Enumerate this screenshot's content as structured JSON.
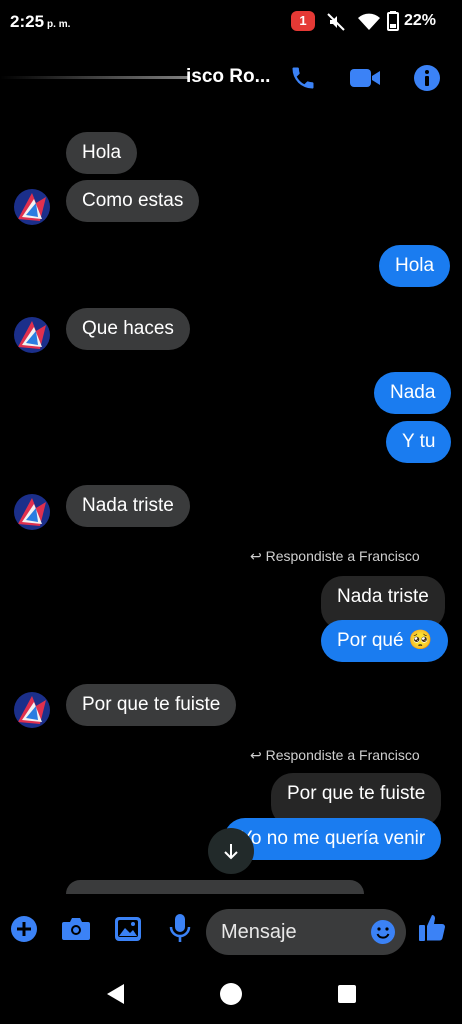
{
  "status_bar": {
    "time": "2:25",
    "time_suffix": "p. m.",
    "notification_count": "1",
    "battery": "22%"
  },
  "header": {
    "contact_name": "isco Ro..."
  },
  "messages": [
    {
      "side": "in",
      "text": "Hola"
    },
    {
      "side": "in",
      "text": "Como estas"
    },
    {
      "side": "out",
      "text": "Hola"
    },
    {
      "side": "in",
      "text": "Que haces"
    },
    {
      "side": "out",
      "text": "Nada"
    },
    {
      "side": "out",
      "text": "Y tu"
    },
    {
      "side": "in",
      "text": "Nada triste"
    },
    {
      "side": "out",
      "reply_label": "Respondiste a Francisco",
      "quoted": "Nada triste",
      "text": "Por qué 🥺"
    },
    {
      "side": "in",
      "text": "Por que te fuiste"
    },
    {
      "side": "out",
      "reply_label": "Respondiste a Francisco",
      "quoted": "Por que te fuiste",
      "text": "Yo no me quería venir"
    }
  ],
  "composer": {
    "placeholder": "Mensaje"
  },
  "colors": {
    "accent": "#1a7cf0",
    "incoming_bubble": "#3a3b3c",
    "quoted_bubble": "#262626",
    "icon_blue": "#3b82f6",
    "badge": "#e53935"
  },
  "icons": {
    "header": [
      "phone-icon",
      "video-camera-icon",
      "info-icon"
    ],
    "composer": [
      "plus-icon",
      "camera-icon",
      "image-icon",
      "microphone-icon",
      "emoji-icon",
      "thumbs-up-icon"
    ],
    "nav": [
      "back-triangle-icon",
      "home-circle-icon",
      "recents-square-icon"
    ]
  }
}
